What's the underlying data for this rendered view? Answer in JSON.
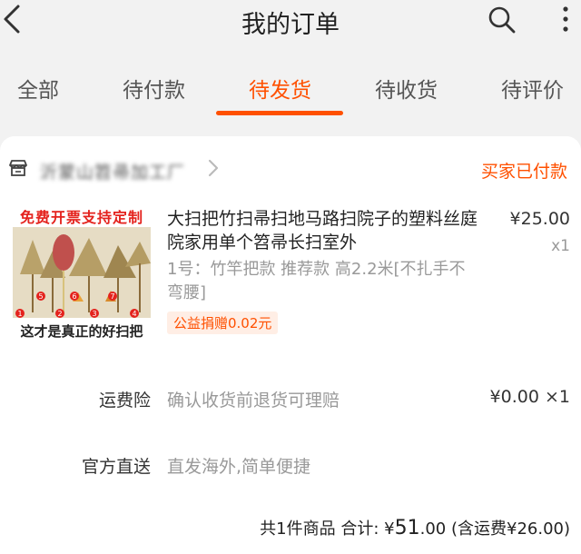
{
  "header": {
    "title": "我的订单",
    "back_icon": "chevron-left-icon",
    "search_icon": "search-icon",
    "more_icon": "more-vertical-icon"
  },
  "tabs": [
    {
      "label": "全部",
      "active": false
    },
    {
      "label": "待付款",
      "active": false
    },
    {
      "label": "待发货",
      "active": true
    },
    {
      "label": "待收货",
      "active": false
    },
    {
      "label": "待评价",
      "active": false
    }
  ],
  "colors": {
    "accent": "#ff5000",
    "page_bg": "#f2f2f2"
  },
  "order": {
    "shop_icon": "store-icon",
    "shop_name": "沂蒙山笤帚加工厂",
    "status": "买家已付款",
    "item": {
      "image_banner_top": "免费开票支持定制",
      "image_banner_bottom": "这才是真正的好扫把",
      "image_markers": [
        "1",
        "2",
        "3",
        "4",
        "5",
        "6",
        "7"
      ],
      "title": "大扫把竹扫帚扫地马路扫院子的塑料丝庭院家用单个笤帚长扫室外",
      "price": "¥25.00",
      "quantity": "x1",
      "sku": "1号：竹竿把款 推荐款 高2.2米[不扎手不弯腰]",
      "charity_tag": "公益捐赠0.02元"
    },
    "freight_insurance": {
      "label": "运费险",
      "value": "确认收货前退货可理赔",
      "price": "¥0.00",
      "quantity": "×1"
    },
    "official_direct": {
      "label": "官方直送",
      "value": "直发海外,简单便捷"
    },
    "summary": {
      "count_text": "共1件商品",
      "total_label": "合计:",
      "currency": "¥",
      "total_int": "51",
      "total_dec": ".00",
      "shipping_note": "(含运费¥26.00)"
    }
  }
}
